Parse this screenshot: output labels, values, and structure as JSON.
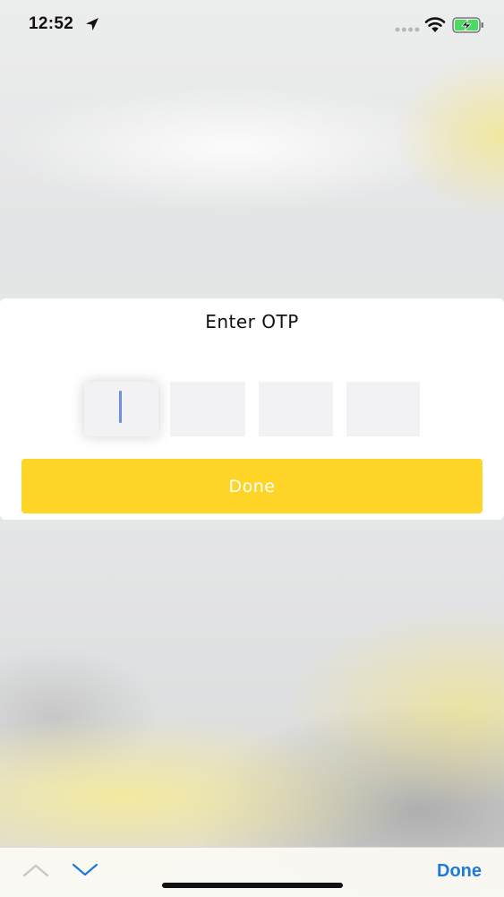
{
  "status_bar": {
    "time": "12:52",
    "icons": [
      "location-arrow-icon",
      "signal-icon",
      "wifi-icon",
      "battery-charging-icon"
    ],
    "battery_color": "#4cd964"
  },
  "dialog": {
    "title": "Enter OTP",
    "otp_boxes": [
      {
        "value": "",
        "focused": true
      },
      {
        "value": "",
        "focused": false
      },
      {
        "value": "",
        "focused": false
      },
      {
        "value": "",
        "focused": false
      }
    ],
    "done_label": "Done",
    "accent_color": "#fed527"
  },
  "keyboard_toolbar": {
    "prev_icon": "chevron-up-icon",
    "next_icon": "chevron-down-icon",
    "done_label": "Done",
    "done_color": "#1e7ad6"
  }
}
